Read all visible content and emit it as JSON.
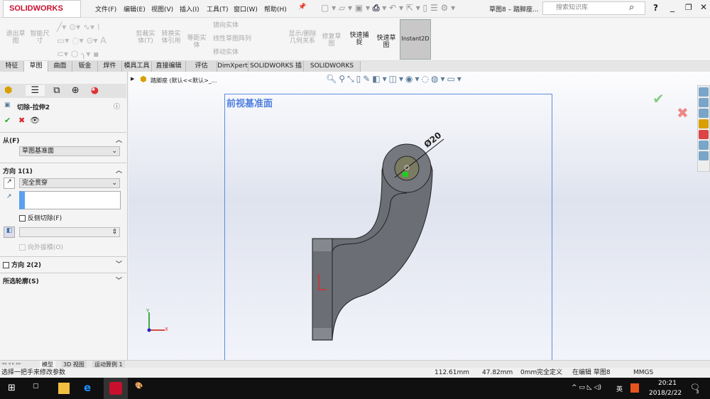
{
  "app": {
    "logo": "SOLIDWORKS",
    "doc_title": "草图8 – 踏脚座...",
    "search_placeholder": "搜索知识库",
    "help": "?"
  },
  "menu": [
    "文件(F)",
    "编辑(E)",
    "视图(V)",
    "插入(I)",
    "工具(T)",
    "窗口(W)",
    "帮助(H)"
  ],
  "ribbon": {
    "buttons": [
      "退出草图",
      "智能尺寸",
      "剪裁实体(T)",
      "转换实体引用",
      "等距实体",
      "显示/删除几何关系",
      "修复草图",
      "快速捕捉",
      "快速草图",
      "Instant2D"
    ],
    "small": [
      "镜向实体",
      "线性草图阵列",
      "移动实体"
    ]
  },
  "tabs": [
    "特征",
    "草图",
    "曲面",
    "钣金",
    "焊件",
    "模具工具",
    "直接编辑",
    "评估",
    "DimXpert",
    "SOLIDWORKS 插件",
    "SOLIDWORKS MBD"
  ],
  "active_tab": "草图",
  "property_manager": {
    "title": "切除-拉伸2",
    "from_label": "从(F)",
    "from_value": "草图基准面",
    "dir1_label": "方向 1(1)",
    "dir1_value": "完全贯穿",
    "reverse_label": "反侧切除(F)",
    "draft_label": "向外拔模(O)",
    "dir2_label": "方向 2(2)",
    "contours_label": "所选轮廓(S)"
  },
  "viewport": {
    "tree_item": "踏脚座 (默认<<默认>_...",
    "plane_label": "前视基准面",
    "dimension": "Ø20",
    "axis_x": "X",
    "axis_y": "Y"
  },
  "bottom_tabs": [
    "模型",
    "3D 视图",
    "运动算例 1"
  ],
  "status": {
    "message": "选择一把手来修改参数",
    "x": "112.61mm",
    "y": "47.82mm",
    "z": "0mm",
    "state": "完全定义",
    "editing": "在编辑 草图8",
    "units": "MMGS"
  },
  "taskbar": {
    "time": "20:21",
    "date": "2018/2/22",
    "ime": "英",
    "notifications": "3"
  },
  "colors": {
    "accent": "#5b8de0",
    "part": "#6b6e74",
    "logo": "#c8102e"
  }
}
